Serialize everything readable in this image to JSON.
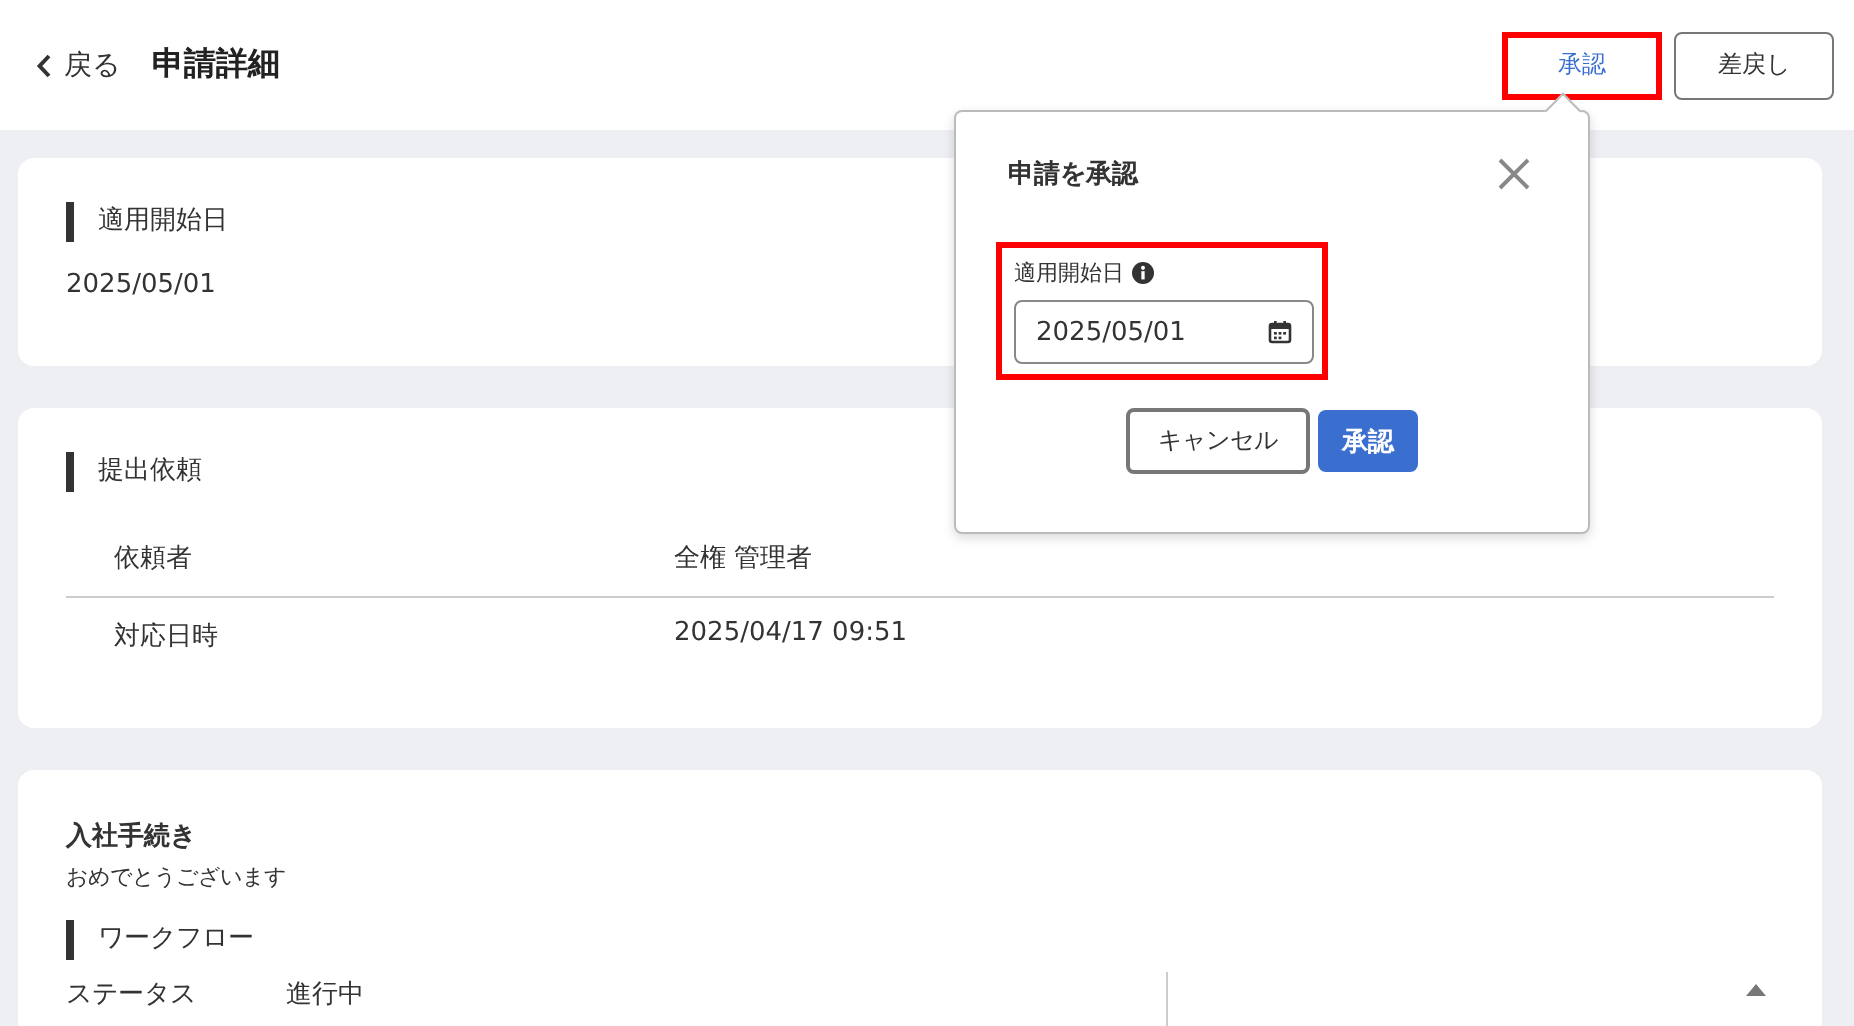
{
  "header": {
    "back_label": "戻る",
    "title": "申請詳細",
    "buttons": [
      {
        "label": "承認",
        "kind": "outline-primary",
        "highlighted": true
      },
      {
        "label": "差戻し",
        "kind": "outline",
        "highlighted": false
      }
    ]
  },
  "sections": [
    {
      "kind": "field",
      "heading": "適用開始日",
      "value": "2025/05/01"
    },
    {
      "kind": "table",
      "heading": "提出依頼",
      "rows": [
        {
          "label": "依頼者",
          "value": "全権 管理者"
        },
        {
          "label": "対応日時",
          "value": "2025/04/17 09:51"
        }
      ]
    },
    {
      "kind": "procedure",
      "title": "入社手続き",
      "description": "おめでとうございます",
      "subheading": "ワークフロー",
      "rows": [
        {
          "label": "ステータス",
          "value": "進行中"
        }
      ]
    }
  ],
  "popover": {
    "title": "申請を承認",
    "field_label": "適用開始日",
    "date_value": "2025/05/01",
    "highlighted": true,
    "buttons": [
      {
        "label": "キャンセル",
        "kind": "outline"
      },
      {
        "label": "承認",
        "kind": "primary"
      }
    ]
  }
}
